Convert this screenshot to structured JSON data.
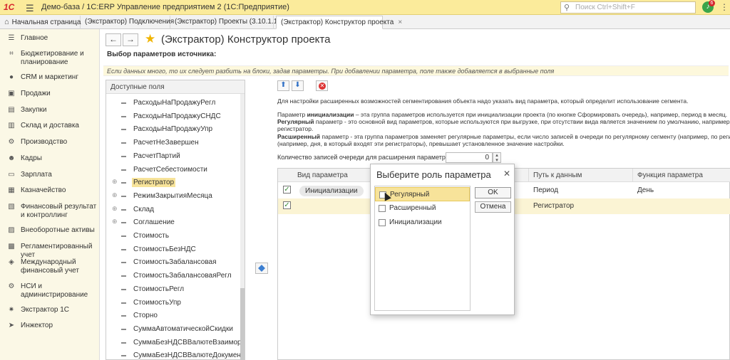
{
  "titlebar": {
    "logo": "1С",
    "title": "Демо-база / 1С:ERP Управление предприятием 2  (1С:Предприятие)",
    "search_placeholder": "Поиск Ctrl+Shift+F",
    "notifications_count": "6"
  },
  "tabs": [
    {
      "label": "Начальная страница"
    },
    {
      "label": "(Экстрактор) Подключения"
    },
    {
      "label": "(Экстрактор) Проекты (3.10.1.19)"
    },
    {
      "label": "(Экстрактор) Конструктор проекта"
    }
  ],
  "sidebar": {
    "items": [
      {
        "label": "Главное",
        "icon": "list-icon"
      },
      {
        "label": "Бюджетирование и планирование",
        "icon": "budget-icon"
      },
      {
        "label": "CRM и маркетинг",
        "icon": "crm-icon"
      },
      {
        "label": "Продажи",
        "icon": "sales-icon"
      },
      {
        "label": "Закупки",
        "icon": "cart-icon"
      },
      {
        "label": "Склад и доставка",
        "icon": "warehouse-icon"
      },
      {
        "label": "Производство",
        "icon": "production-icon"
      },
      {
        "label": "Кадры",
        "icon": "people-icon"
      },
      {
        "label": "Зарплата",
        "icon": "salary-icon"
      },
      {
        "label": "Казначейство",
        "icon": "treasury-icon"
      },
      {
        "label": "Финансовый результат и контроллинг",
        "icon": "finance-icon"
      },
      {
        "label": "Внеоборотные активы",
        "icon": "assets-icon"
      },
      {
        "label": "Регламентированный учет",
        "icon": "accounting-icon"
      },
      {
        "label": "Международный финансовый учет",
        "icon": "intl-icon"
      },
      {
        "label": "НСИ и администрирование",
        "icon": "gear-icon"
      },
      {
        "label": "Экстрактор 1С",
        "icon": "extractor-icon"
      },
      {
        "label": "Инжектор",
        "icon": "injector-icon"
      }
    ]
  },
  "main": {
    "title": "(Экстрактор) Конструктор проекта",
    "section_label": "Выбор параметров источника:",
    "hint": "Если данных много, то их следует разбить на блоки, задав параметры. При добавлении параметра, поле также добавляется в выбранные поля",
    "tree_header": "Доступные поля",
    "tree_items": [
      {
        "label": "РасходыНаПродажуРегл",
        "expandable": false
      },
      {
        "label": "РасходыНаПродажуСНДС",
        "expandable": false
      },
      {
        "label": "РасходыНаПродажуУпр",
        "expandable": false
      },
      {
        "label": "РасчетНеЗавершен",
        "expandable": false
      },
      {
        "label": "РасчетПартий",
        "expandable": false
      },
      {
        "label": "РасчетСебестоимости",
        "expandable": false
      },
      {
        "label": "Регистратор",
        "expandable": true,
        "selected": true
      },
      {
        "label": "РежимЗакрытияМесяца",
        "expandable": true
      },
      {
        "label": "Склад",
        "expandable": true
      },
      {
        "label": "Соглашение",
        "expandable": true
      },
      {
        "label": "Стоимость",
        "expandable": false
      },
      {
        "label": "СтоимостьБезНДС",
        "expandable": false
      },
      {
        "label": "СтоимостьЗабалансовая",
        "expandable": false
      },
      {
        "label": "СтоимостьЗабалансоваяРегл",
        "expandable": false
      },
      {
        "label": "СтоимостьРегл",
        "expandable": false
      },
      {
        "label": "СтоимостьУпр",
        "expandable": false
      },
      {
        "label": "Сторно",
        "expandable": false
      },
      {
        "label": "СуммаАвтоматическойСкидки",
        "expandable": false
      },
      {
        "label": "СуммаБезНДСВВалютеВзаиморасче...",
        "expandable": false
      },
      {
        "label": "СуммаБезНДСВВалютеДокумента",
        "expandable": false
      }
    ],
    "description": {
      "line1": "Для настройки расширенных возможностей сегментирования объекта надо указать вид параметра, который определит использование сегмента.",
      "line2_prefix": "Параметр ",
      "line2_bold": "инициализации",
      "line2_rest": " – эта группа параметров используется при инициализации проекта (по кнопке Сформировать очередь), например, период в месяц.",
      "line3_bold": "Регулярный",
      "line3_rest": " параметр - это основной вид параметров, которые используются при выгрузке, при отсутствии вида является значением по умолчанию, например в",
      "line4": "регистратор.",
      "line5_bold": "Расширенный",
      "line5_rest": " параметр - эта группа параметров заменяет регулярные параметры, если число записей в очереди по регулярному сегменту (например, по регис",
      "line6": "(например, дня, в который входят эти регистраторы), превышает установленное значение настройки."
    },
    "count_label": "Количество записей очереди для расширения параметров:",
    "count_value": "0",
    "grid": {
      "columns": [
        "Вид параметра",
        "Путь к данным",
        "Функция параметра"
      ],
      "rows": [
        {
          "checked": true,
          "kind": "Инициализации",
          "path": "Период",
          "function": "День"
        },
        {
          "checked": true,
          "kind": "",
          "path": "Регистратор",
          "function": ""
        }
      ]
    }
  },
  "dialog": {
    "title": "Выберите роль параметра",
    "options": [
      {
        "label": "Регулярный",
        "checked": false,
        "selected": true
      },
      {
        "label": "Расширенный",
        "checked": false
      },
      {
        "label": "Инициализации",
        "checked": false
      }
    ],
    "ok_label": "OK",
    "cancel_label": "Отмена"
  },
  "colors": {
    "titlebar_bg": "#fbeb9b",
    "sidebar_bg": "#fbf8e6",
    "selection": "#f7e39a",
    "accent_blue": "#2f6fc5"
  }
}
